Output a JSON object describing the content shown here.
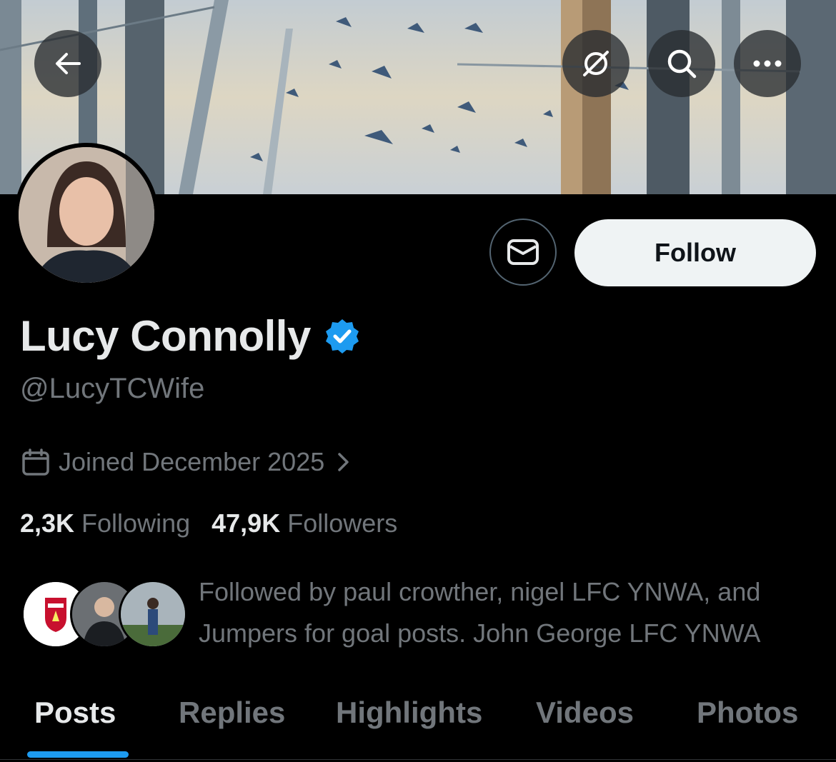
{
  "header": {
    "back_icon": "arrow-left-icon",
    "translate_icon": "translate-off-icon",
    "search_icon": "search-icon",
    "more_icon": "more-horizontal-icon"
  },
  "profile": {
    "display_name": "Lucy Connolly",
    "verified": true,
    "verified_color": "#1d9bf0",
    "handle": "@LucyTCWife",
    "joined": "Joined December 2025",
    "following_count": "2,3K",
    "following_label": "Following",
    "followers_count": "47,9K",
    "followers_label": "Followers",
    "followed_by_text": "Followed by paul crowther, nigel LFC YNWA, and Jumpers for goal posts. John George LFC YNWA"
  },
  "actions": {
    "message_icon": "envelope-icon",
    "follow_label": "Follow"
  },
  "tabs": [
    {
      "label": "Posts",
      "active": true
    },
    {
      "label": "Replies",
      "active": false
    },
    {
      "label": "Highlights",
      "active": false
    },
    {
      "label": "Videos",
      "active": false
    },
    {
      "label": "Photos",
      "active": false
    }
  ],
  "colors": {
    "accent": "#1d9bf0",
    "background": "#000000",
    "secondary_text": "#71767b",
    "primary_text": "#e7e9ea"
  }
}
